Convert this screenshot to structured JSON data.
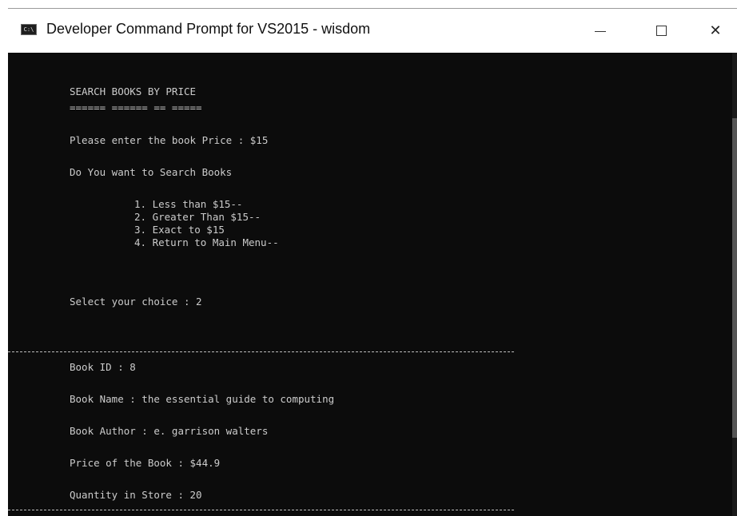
{
  "window": {
    "title": "Developer Command Prompt for VS2015 - wisdom",
    "icon": "cmd-icon",
    "icon_text": "C:\\"
  },
  "controls": {
    "minimize_icon": "minimize-icon",
    "maximize_icon": "maximize-icon",
    "close_icon": "close-icon",
    "close_glyph": "✕"
  },
  "console": {
    "header": "SEARCH BOOKS BY PRICE",
    "underline": "====== ====== == =====",
    "price_prompt": "Please enter the book Price : $15",
    "question": "Do You want to Search Books",
    "options": [
      "1. Less than $15--",
      "2. Greater Than $15--",
      "3. Exact to $15",
      "4. Return to Main Menu--"
    ],
    "choice_prompt": "Select your choice : 2",
    "result": {
      "book_id": "Book ID : 8",
      "book_name": "Book Name : the essential guide to computing",
      "book_author": "Book Author : e. garrison walters",
      "price": "Price of the Book : $44.9",
      "quantity": "Quantity in Store : 20"
    }
  },
  "colors": {
    "console_bg": "#0c0c0c",
    "console_text": "#cccccc",
    "titlebar_bg": "#ffffff"
  }
}
